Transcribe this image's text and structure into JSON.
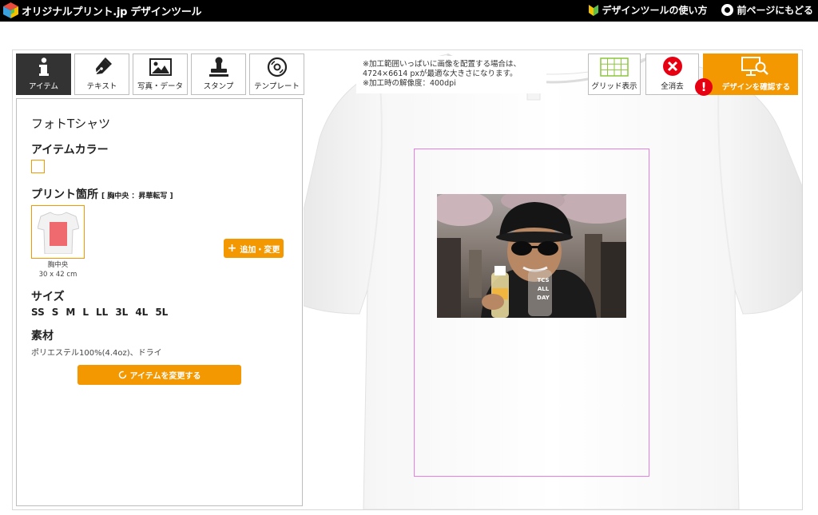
{
  "header": {
    "logo_text": "オリジナルプリント.jp デザインツール",
    "how_to_label": "デザインツールの使い方",
    "back_label": "前ページにもどる"
  },
  "tools": [
    {
      "label": "アイテム",
      "icon": "info-icon",
      "active": true
    },
    {
      "label": "テキスト",
      "icon": "pen-icon",
      "active": false
    },
    {
      "label": "写真・データ",
      "icon": "image-icon",
      "active": false
    },
    {
      "label": "スタンプ",
      "icon": "stamp-icon",
      "active": false
    },
    {
      "label": "テンプレート",
      "icon": "disc-icon",
      "active": false
    }
  ],
  "panel": {
    "item_name": "フォトTシャツ",
    "color_heading": "アイテムカラー",
    "print_heading": "プリント箇所",
    "print_detail": "[ 胸中央 ：昇華転写 ]",
    "print_position_name": "胸中央",
    "print_position_size": "30 x 42 cm",
    "add_change_label": "追加・変更",
    "size_heading": "サイズ",
    "sizes": [
      "SS",
      "S",
      "M",
      "L",
      "LL",
      "3L",
      "4L",
      "5L"
    ],
    "material_heading": "素材",
    "material_text": "ポリエステル100%(4.4oz)、ドライ",
    "change_item_label": "アイテムを変更する"
  },
  "canvas": {
    "notice_line1": "※加工範囲いっぱいに画像を配置する場合は、",
    "notice_line2": "4724×6614 pxが最適な大きさになります。",
    "notice_line3": "※加工時の解像度：400dpi",
    "bottle_text_1": "TCS",
    "bottle_text_2": "ALL",
    "bottle_text_3": "DAY"
  },
  "actions": {
    "grid_label": "グリッド表示",
    "clear_label": "全消去",
    "confirm_label": "デザインを確認する",
    "alert_mark": "!"
  },
  "colors": {
    "accent": "#f39800",
    "print_area_border": "#e77ee6",
    "clear_red": "#e60012",
    "grid_green": "#8cc63f"
  }
}
